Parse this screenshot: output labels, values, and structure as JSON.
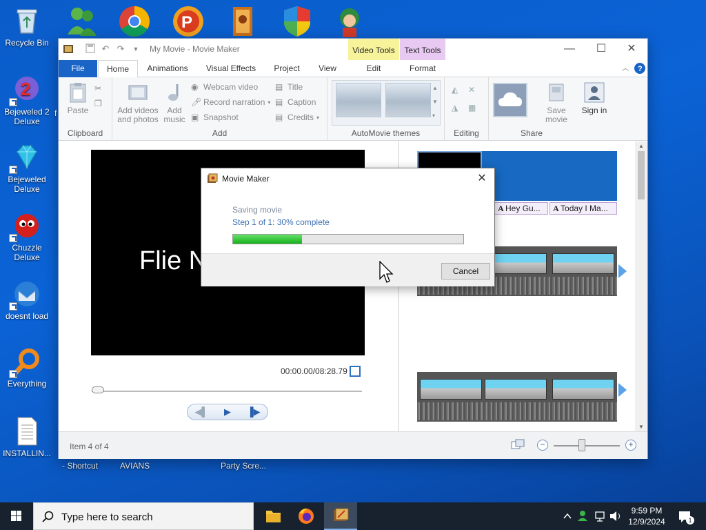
{
  "desktop": {
    "icons": [
      {
        "label": "Recycle Bin"
      },
      {
        "label": "Bejeweled 2 Deluxe"
      },
      {
        "label": "Bejeweled Deluxe"
      },
      {
        "label": "Chuzzle Deluxe"
      },
      {
        "label": "doesnt load"
      },
      {
        "label": "Everything"
      },
      {
        "label": "INSTALLIN..."
      }
    ],
    "partial_labels": [
      "- Shortcut",
      "AVIANS",
      "Party Scre...",
      "f"
    ]
  },
  "window": {
    "title": "My Movie - Movie Maker",
    "context_tabs": {
      "video_tools": "Video Tools",
      "text_tools": "Text Tools",
      "edit": "Edit",
      "format": "Format"
    },
    "tabs": [
      "File",
      "Home",
      "Animations",
      "Visual Effects",
      "Project",
      "View"
    ],
    "ribbon": {
      "clipboard": {
        "paste": "Paste",
        "group": "Clipboard"
      },
      "add": {
        "add_videos": "Add videos and photos",
        "add_music": "Add music",
        "webcam": "Webcam video",
        "narration": "Record narration",
        "snapshot": "Snapshot",
        "title": "Title",
        "caption": "Caption",
        "credits": "Credits",
        "group": "Add"
      },
      "themes": {
        "group": "AutoMovie themes"
      },
      "editing": {
        "group": "Editing"
      },
      "share": {
        "save_movie": "Save movie",
        "sign_in": "Sign in",
        "group": "Share"
      }
    },
    "preview": {
      "video_text": "Flie N",
      "timecode": "00:00.00/08:28.79"
    },
    "storyboard": {
      "captions": [
        "Hey Gu...",
        "Today I Ma..."
      ]
    },
    "status": {
      "item": "Item 4 of 4"
    }
  },
  "dialog": {
    "title": "Movie Maker",
    "line1": "Saving movie",
    "line2": "Step 1 of 1: 30% complete",
    "progress_percent": 30,
    "cancel": "Cancel"
  },
  "taskbar": {
    "search_placeholder": "Type here to search",
    "time": "9:59 PM",
    "date": "12/9/2024",
    "notification_count": "1"
  },
  "colors": {
    "accent": "#1a64c8",
    "video_tools_tab": "#f7f39a",
    "text_tools_tab": "#e8c9f2",
    "progress": "#16b11c"
  }
}
